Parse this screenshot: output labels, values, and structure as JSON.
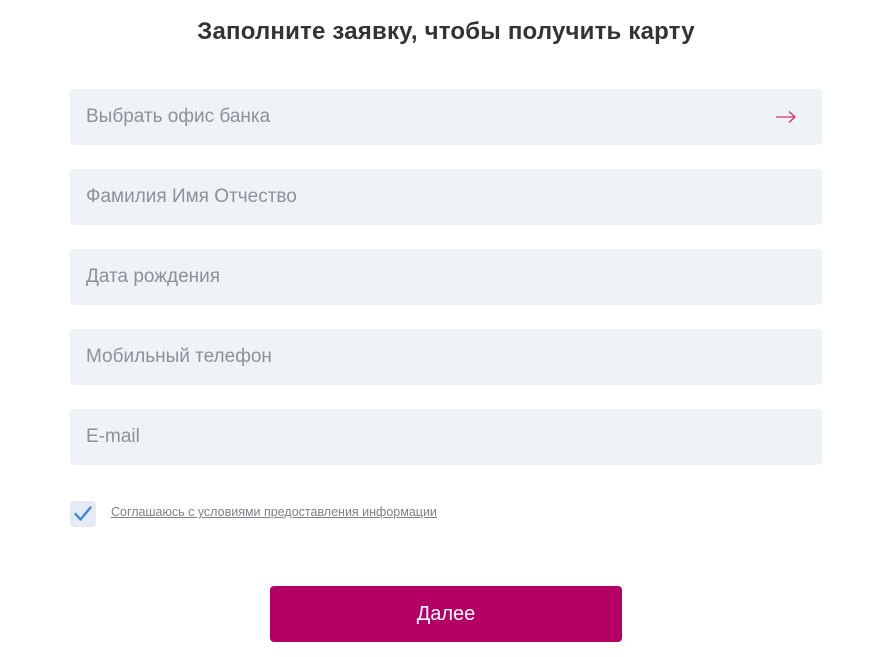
{
  "form": {
    "title": "Заполните заявку, чтобы получить карту",
    "fields": [
      {
        "name": "office",
        "value": "",
        "placeholder": "Выбрать офис банка",
        "icon": "arrow-right-icon"
      },
      {
        "name": "full_name",
        "value": "",
        "placeholder": "Фамилия Имя Отчество"
      },
      {
        "name": "birth_date",
        "value": "",
        "placeholder": "Дата рождения"
      },
      {
        "name": "phone",
        "value": "",
        "placeholder": "Мобильный телефон"
      },
      {
        "name": "email",
        "value": "",
        "placeholder": "E-mail"
      }
    ],
    "consent": {
      "checked": true,
      "label": "Соглашаюсь с условиями предоставления информации"
    },
    "submit_label": "Далее"
  },
  "colors": {
    "accent": "#b40064",
    "field_background": "#eff3f8",
    "checkmark": "#3b87e6",
    "arrow": "#d6335f"
  }
}
